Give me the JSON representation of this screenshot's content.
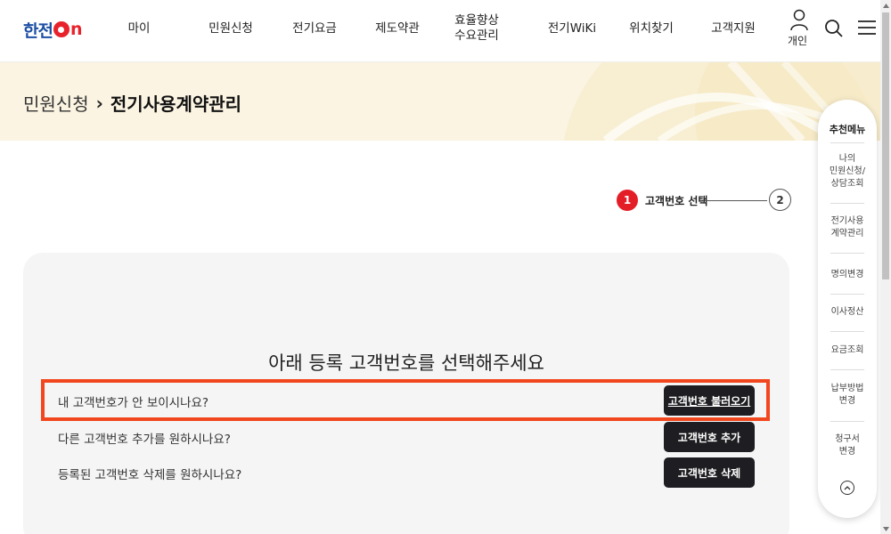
{
  "header": {
    "logo_text": "한전",
    "logo_on_suffix": "n",
    "nav": [
      {
        "label": "마이"
      },
      {
        "label": "민원신청"
      },
      {
        "label": "전기요금"
      },
      {
        "label": "제도약관"
      },
      {
        "label_line1": "효율향상",
        "label_line2": "수요관리"
      },
      {
        "label": "전기WiKi"
      },
      {
        "label": "위치찾기"
      },
      {
        "label": "고객지원"
      }
    ],
    "person_label": "개인"
  },
  "breadcrumb": {
    "parent": "민원신청",
    "separator": "›",
    "current": "전기사용계약관리"
  },
  "stepper": {
    "step1_number": "1",
    "step1_label": "고객번호 선택",
    "step2_number": "2"
  },
  "main": {
    "title": "아래 등록 고객번호를 선택해주세요",
    "rows": [
      {
        "text": "내 고객번호가 안 보이시나요?",
        "button": "고객번호 불러오기"
      },
      {
        "text": "다른 고객번호 추가를 원하시나요?",
        "button": "고객번호 추가"
      },
      {
        "text": "등록된 고객번호 삭제를 원하시나요?",
        "button": "고객번호 삭제"
      }
    ]
  },
  "quick_menu": {
    "title": "추천메뉴",
    "items": [
      {
        "line1": "나의",
        "line2": "민원신청/",
        "line3": "상담조회"
      },
      {
        "line1": "전기사용",
        "line2": "계약관리"
      },
      {
        "line1": "명의변경"
      },
      {
        "line1": "이사정산"
      },
      {
        "line1": "요금조회"
      },
      {
        "line1": "납부방법",
        "line2": "변경"
      },
      {
        "line1": "청구서",
        "line2": "변경"
      }
    ]
  },
  "colors": {
    "brand_blue": "#1c4fa3",
    "brand_red": "#e8222b",
    "highlight": "#f2471e",
    "button_dark": "#1e1e22",
    "banner_bg": "#fbf4e2"
  }
}
